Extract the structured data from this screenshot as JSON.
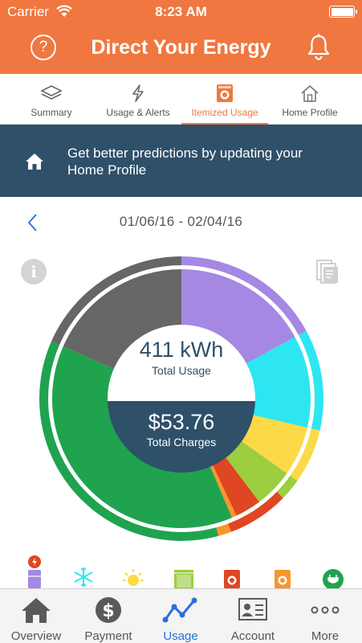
{
  "status_bar": {
    "carrier": "Carrier",
    "time": "8:23 AM"
  },
  "header": {
    "title": "Direct Your Energy",
    "help_symbol": "?"
  },
  "tabs": [
    {
      "label": "Summary",
      "icon": "layers-icon",
      "active": false
    },
    {
      "label": "Usage & Alerts",
      "icon": "lightning-icon",
      "active": false
    },
    {
      "label": "Itemized Usage",
      "icon": "appliance-icon",
      "active": true
    },
    {
      "label": "Home Profile",
      "icon": "house-icon",
      "active": false
    }
  ],
  "banner": {
    "text": "Get better predictions by updating your Home Profile"
  },
  "period": {
    "range": "01/06/16 - 02/04/16"
  },
  "info_symbol": "i",
  "summary": {
    "usage_value": "411 kWh",
    "usage_label": "Total Usage",
    "charges_value": "$53.76",
    "charges_label": "Total Charges"
  },
  "colors": {
    "brand": "#f0773f",
    "banner": "#2e5069",
    "charges_block": "#2e5069",
    "nav_active": "#2a6fdb"
  },
  "chart_data": {
    "type": "pie",
    "variant": "donut",
    "segments": [
      {
        "color": "#a488e3",
        "share": 0.171
      },
      {
        "color": "#2de6f2",
        "share": 0.115
      },
      {
        "color": "#fcd947",
        "share": 0.062
      },
      {
        "color": "#9cce3f",
        "share": 0.049
      },
      {
        "color": "#df4622",
        "share": 0.033
      },
      {
        "color": "#f7962f",
        "share": 0.006
      },
      {
        "color": "#1fa34f",
        "share": 0.38
      },
      {
        "color": "#666666",
        "share": 0.184
      }
    ],
    "outer_ring": [
      {
        "color": "#a488e3",
        "share": 0.171
      },
      {
        "color": "#2de6f2",
        "share": 0.115
      },
      {
        "color": "#fcd947",
        "share": 0.062
      },
      {
        "color": "#9cce3f",
        "share": 0.025
      },
      {
        "color": "#df4622",
        "share": 0.07
      },
      {
        "color": "#f7962f",
        "share": 0.015
      },
      {
        "color": "#1fa34f",
        "share": 0.358
      },
      {
        "color": "#666666",
        "share": 0.184
      }
    ]
  },
  "legend_icons": [
    {
      "icon": "refrigerator-icon",
      "color": "#a488e3"
    },
    {
      "icon": "snowflake-heater-icon",
      "color": "#2de6f2"
    },
    {
      "icon": "sun-lighting-icon",
      "color": "#fcd947"
    },
    {
      "icon": "dishwasher-icon",
      "color": "#9cce3f"
    },
    {
      "icon": "washer-icon",
      "color": "#df4622"
    },
    {
      "icon": "dryer-icon",
      "color": "#f7962f"
    },
    {
      "icon": "plug-icon",
      "color": "#1fa34f"
    }
  ],
  "bottom_nav": [
    {
      "label": "Overview",
      "icon": "house-icon",
      "active": false
    },
    {
      "label": "Payment",
      "icon": "dollar-icon",
      "active": false
    },
    {
      "label": "Usage",
      "icon": "line-graph-icon",
      "active": true
    },
    {
      "label": "Account",
      "icon": "id-card-icon",
      "active": false
    },
    {
      "label": "More",
      "icon": "more-dots-icon",
      "active": false
    }
  ]
}
